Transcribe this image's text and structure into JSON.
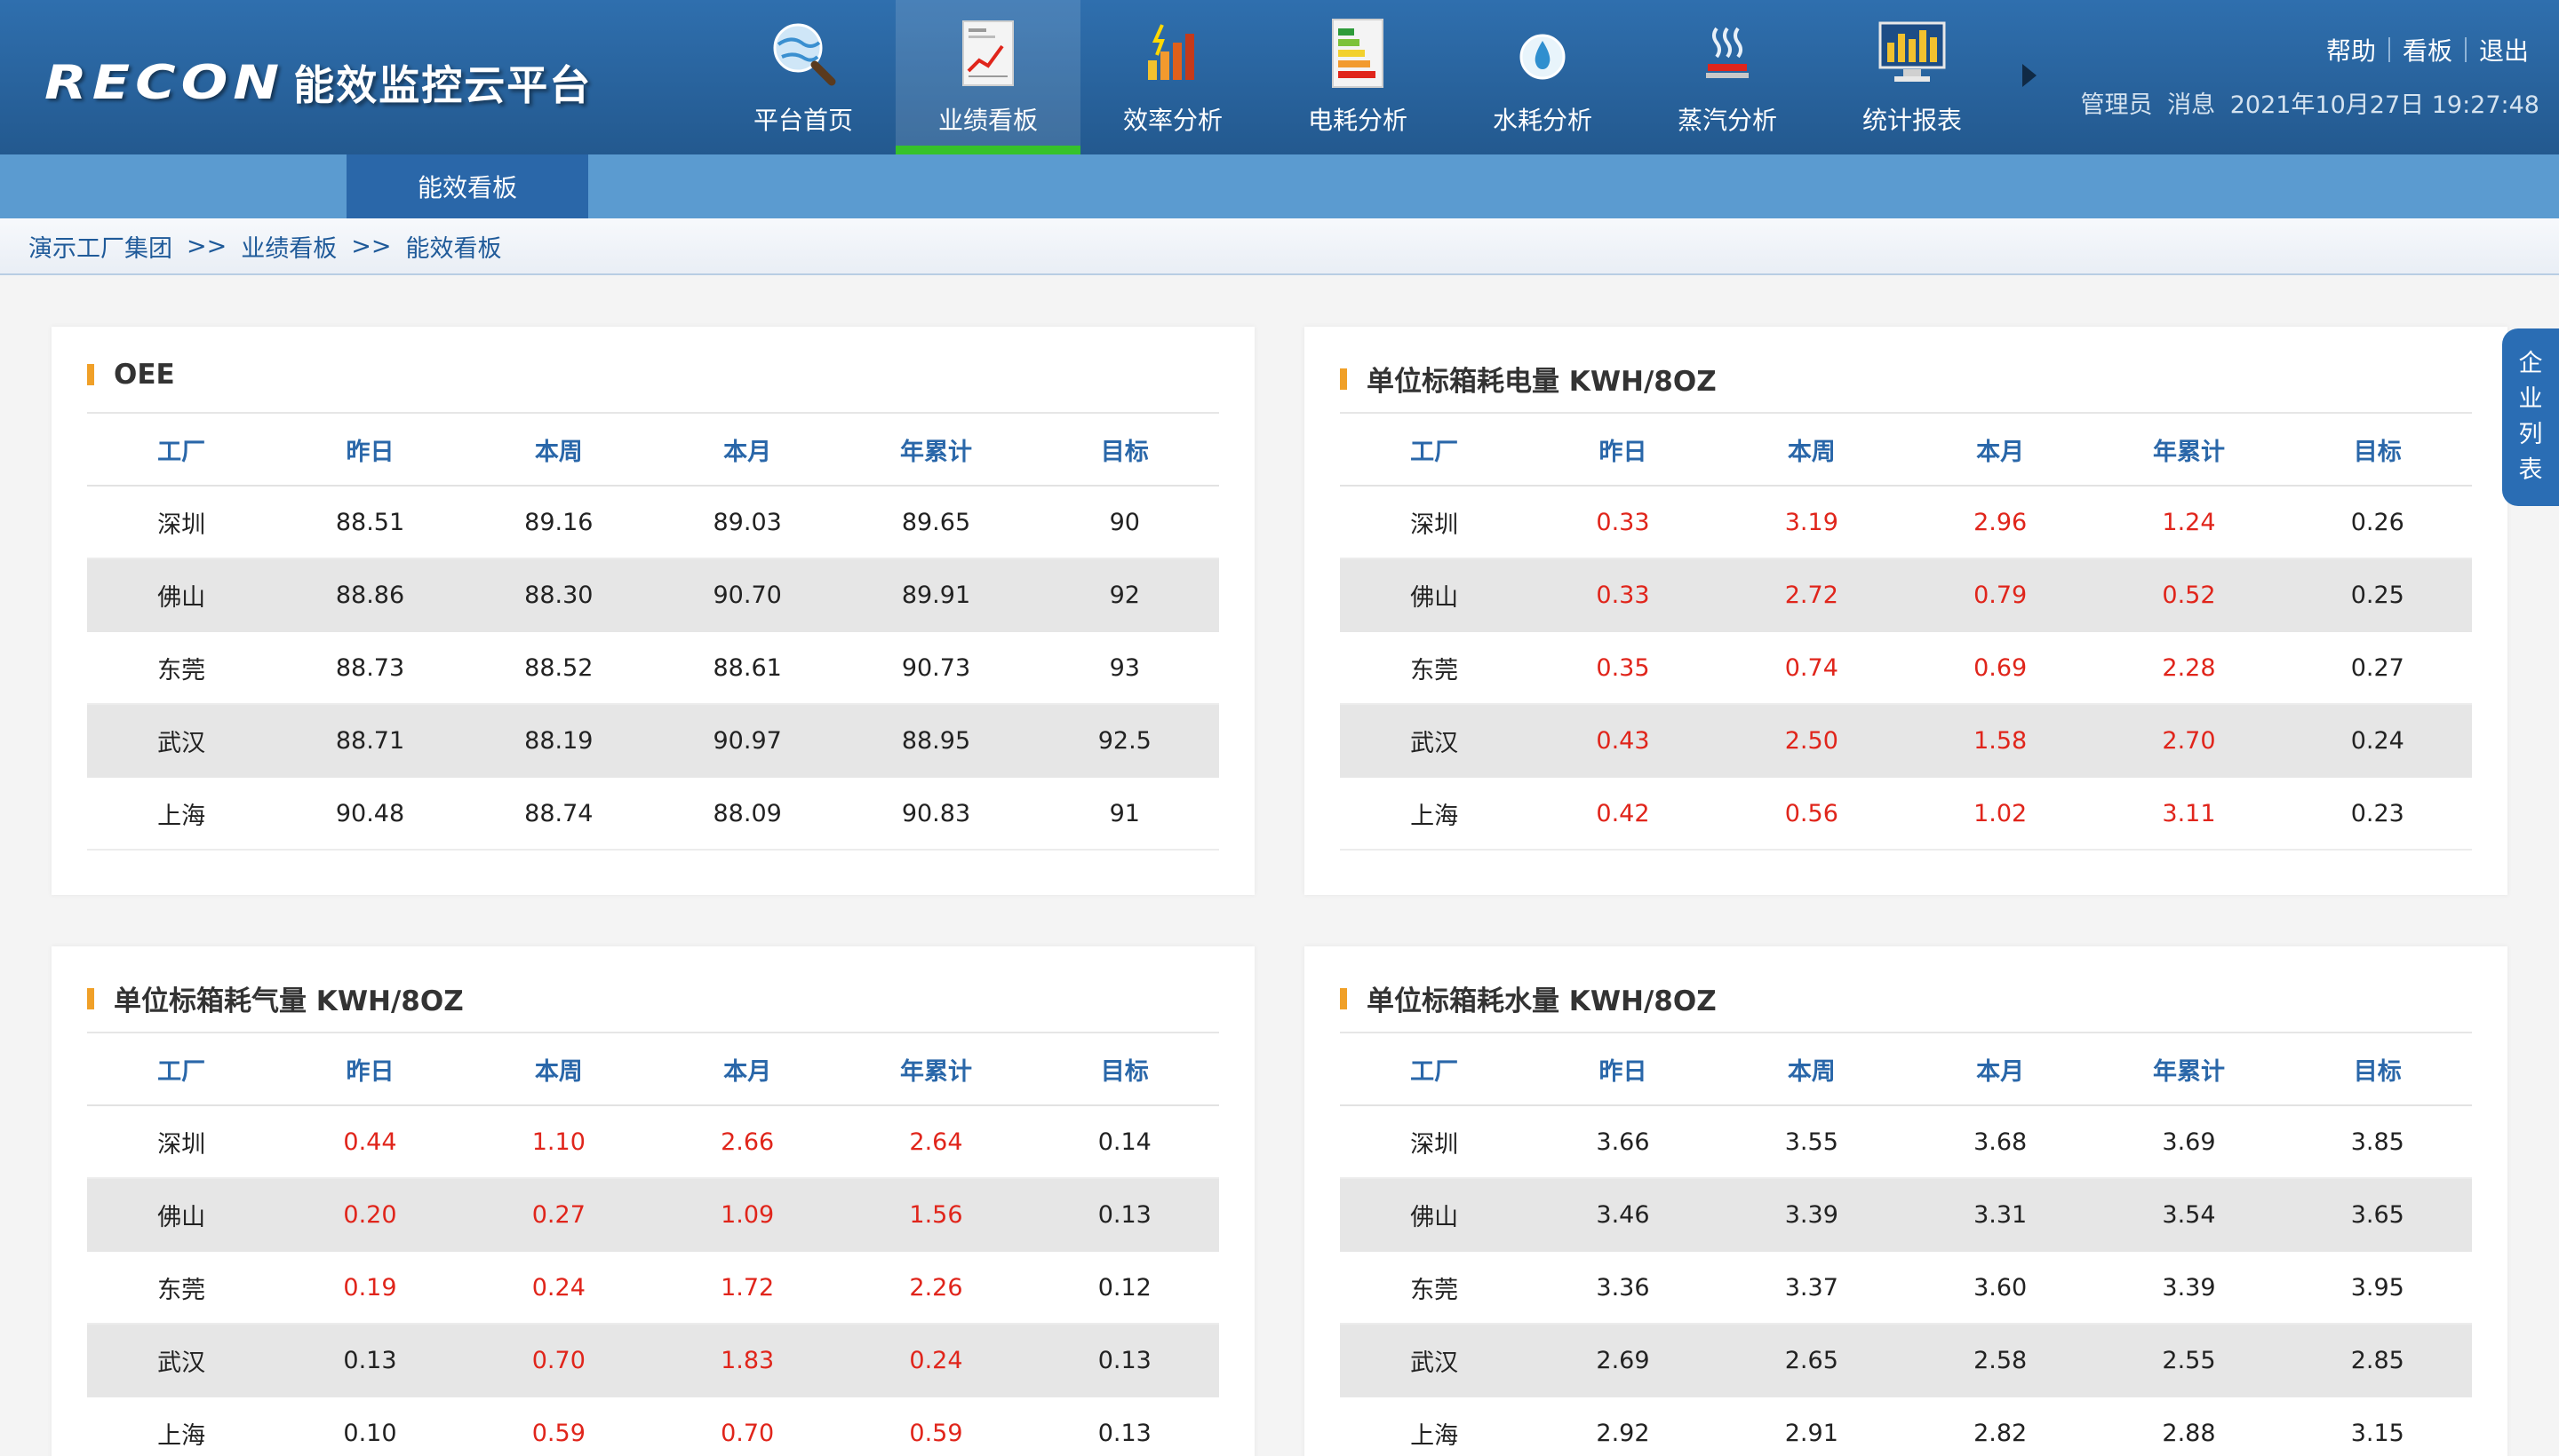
{
  "header": {
    "logo_text": "RECON",
    "logo_subtitle": "能效监控云平台",
    "nav": [
      {
        "label": "平台首页",
        "icon": "globe-search-icon"
      },
      {
        "label": "业绩看板",
        "icon": "chart-report-icon",
        "active": true
      },
      {
        "label": "效率分析",
        "icon": "bar-chart-icon"
      },
      {
        "label": "电耗分析",
        "icon": "energy-level-icon"
      },
      {
        "label": "水耗分析",
        "icon": "water-drop-icon"
      },
      {
        "label": "蒸汽分析",
        "icon": "steam-icon"
      },
      {
        "label": "统计报表",
        "icon": "monitor-report-icon"
      }
    ],
    "links": {
      "help": "帮助",
      "board": "看板",
      "logout": "退出"
    },
    "user": "管理员",
    "message": "消息",
    "datetime": "2021年10月27日 19:27:48"
  },
  "subnav": {
    "tab": "能效看板"
  },
  "breadcrumb": {
    "items": [
      "演示工厂集团",
      "业绩看板",
      "能效看板"
    ],
    "sep": ">>"
  },
  "sidetab": {
    "chars": [
      "企",
      "业",
      "列",
      "表"
    ]
  },
  "colors": {
    "header": "#2a67a9",
    "accent_green": "#36c22b",
    "over_target": "#e0251b",
    "title_mark": "#f0a028"
  },
  "panels": [
    {
      "title": "OEE",
      "columns": [
        "工厂",
        "昨日",
        "本周",
        "本月",
        "年累计",
        "目标"
      ],
      "rows": [
        {
          "cells": [
            "深圳",
            "88.51",
            "89.16",
            "89.03",
            "89.65",
            "90"
          ],
          "red": []
        },
        {
          "cells": [
            "佛山",
            "88.86",
            "88.30",
            "90.70",
            "89.91",
            "92"
          ],
          "red": []
        },
        {
          "cells": [
            "东莞",
            "88.73",
            "88.52",
            "88.61",
            "90.73",
            "93"
          ],
          "red": []
        },
        {
          "cells": [
            "武汉",
            "88.71",
            "88.19",
            "90.97",
            "88.95",
            "92.5"
          ],
          "red": []
        },
        {
          "cells": [
            "上海",
            "90.48",
            "88.74",
            "88.09",
            "90.83",
            "91"
          ],
          "red": []
        }
      ]
    },
    {
      "title": "单位标箱耗电量 KWH/8OZ",
      "columns": [
        "工厂",
        "昨日",
        "本周",
        "本月",
        "年累计",
        "目标"
      ],
      "rows": [
        {
          "cells": [
            "深圳",
            "0.33",
            "3.19",
            "2.96",
            "1.24",
            "0.26"
          ],
          "red": [
            1,
            2,
            3,
            4
          ]
        },
        {
          "cells": [
            "佛山",
            "0.33",
            "2.72",
            "0.79",
            "0.52",
            "0.25"
          ],
          "red": [
            1,
            2,
            3,
            4
          ]
        },
        {
          "cells": [
            "东莞",
            "0.35",
            "0.74",
            "0.69",
            "2.28",
            "0.27"
          ],
          "red": [
            1,
            2,
            3,
            4
          ]
        },
        {
          "cells": [
            "武汉",
            "0.43",
            "2.50",
            "1.58",
            "2.70",
            "0.24"
          ],
          "red": [
            1,
            2,
            3,
            4
          ]
        },
        {
          "cells": [
            "上海",
            "0.42",
            "0.56",
            "1.02",
            "3.11",
            "0.23"
          ],
          "red": [
            1,
            2,
            3,
            4
          ]
        }
      ]
    },
    {
      "title": "单位标箱耗气量 KWH/8OZ",
      "columns": [
        "工厂",
        "昨日",
        "本周",
        "本月",
        "年累计",
        "目标"
      ],
      "rows": [
        {
          "cells": [
            "深圳",
            "0.44",
            "1.10",
            "2.66",
            "2.64",
            "0.14"
          ],
          "red": [
            1,
            2,
            3,
            4
          ]
        },
        {
          "cells": [
            "佛山",
            "0.20",
            "0.27",
            "1.09",
            "1.56",
            "0.13"
          ],
          "red": [
            1,
            2,
            3,
            4
          ]
        },
        {
          "cells": [
            "东莞",
            "0.19",
            "0.24",
            "1.72",
            "2.26",
            "0.12"
          ],
          "red": [
            1,
            2,
            3,
            4
          ]
        },
        {
          "cells": [
            "武汉",
            "0.13",
            "0.70",
            "1.83",
            "0.24",
            "0.13"
          ],
          "red": [
            2,
            3,
            4
          ]
        },
        {
          "cells": [
            "上海",
            "0.10",
            "0.59",
            "0.70",
            "0.59",
            "0.13"
          ],
          "red": [
            2,
            3,
            4
          ]
        }
      ]
    },
    {
      "title": "单位标箱耗水量 KWH/8OZ",
      "columns": [
        "工厂",
        "昨日",
        "本周",
        "本月",
        "年累计",
        "目标"
      ],
      "rows": [
        {
          "cells": [
            "深圳",
            "3.66",
            "3.55",
            "3.68",
            "3.69",
            "3.85"
          ],
          "red": []
        },
        {
          "cells": [
            "佛山",
            "3.46",
            "3.39",
            "3.31",
            "3.54",
            "3.65"
          ],
          "red": []
        },
        {
          "cells": [
            "东莞",
            "3.36",
            "3.37",
            "3.60",
            "3.39",
            "3.95"
          ],
          "red": []
        },
        {
          "cells": [
            "武汉",
            "2.69",
            "2.65",
            "2.58",
            "2.55",
            "2.85"
          ],
          "red": []
        },
        {
          "cells": [
            "上海",
            "2.92",
            "2.91",
            "2.82",
            "2.88",
            "3.15"
          ],
          "red": []
        }
      ]
    }
  ]
}
